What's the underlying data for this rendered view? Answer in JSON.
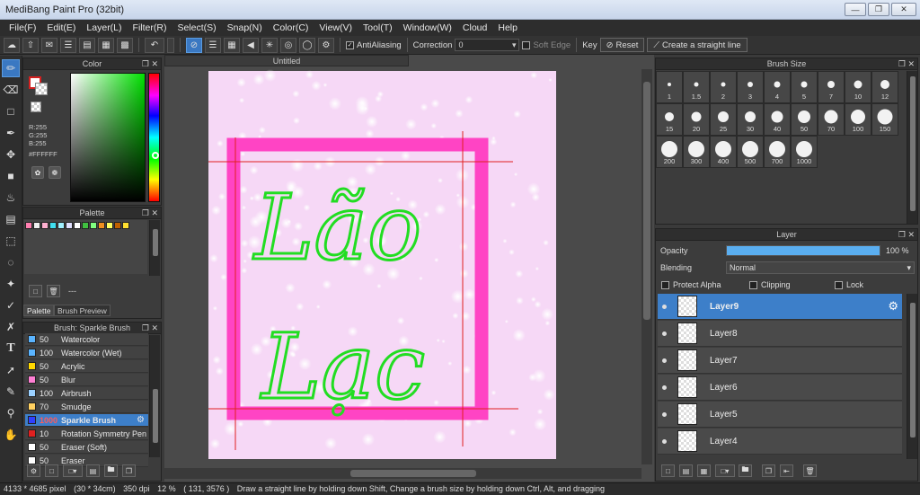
{
  "window": {
    "title": "MediBang Paint Pro (32bit)"
  },
  "menu": [
    "File(F)",
    "Edit(E)",
    "Layer(L)",
    "Filter(R)",
    "Select(S)",
    "Snap(N)",
    "Color(C)",
    "View(V)",
    "Tool(T)",
    "Window(W)",
    "Cloud",
    "Help"
  ],
  "toolbar": {
    "antialiasing_label": "AntiAliasing",
    "correction_label": "Correction",
    "correction_value": "0",
    "soft_edge_label": "Soft Edge",
    "key_label": "Key",
    "reset_label": "Reset",
    "straight_line_label": "Create a straight line"
  },
  "color_panel": {
    "title": "Color",
    "rgb": [
      "R:255",
      "G:255",
      "B:255"
    ],
    "hex": "#FFFFFF",
    "main_color": "#ffffff",
    "sub_color": "#ffffff"
  },
  "palette_panel": {
    "title": "Palette",
    "colors": [
      "#ff7fb0",
      "#f0f0f0",
      "#ffb0d0",
      "#40e0f0",
      "#a0f0ff",
      "#e0e0ff",
      "#ffffff",
      "#40c040",
      "#80ff80",
      "#f09020",
      "#ffff60",
      "#c06000",
      "#ffe030"
    ],
    "name_value": "---",
    "tabs": [
      "Palette",
      "Brush Preview"
    ]
  },
  "brush_panel": {
    "title": "Brush: Sparkle Brush",
    "items": [
      {
        "size": "50",
        "name": "Watercolor",
        "color": "#5ab4ff",
        "selected": false
      },
      {
        "size": "100",
        "name": "Watercolor (Wet)",
        "color": "#5ab4ff",
        "selected": false
      },
      {
        "size": "50",
        "name": "Acrylic",
        "color": "#ffd800",
        "selected": false
      },
      {
        "size": "50",
        "name": "Blur",
        "color": "#ff7fd4",
        "selected": false
      },
      {
        "size": "100",
        "name": "Airbrush",
        "color": "#9ad0ff",
        "selected": false
      },
      {
        "size": "70",
        "name": "Smudge",
        "color": "#ffd060",
        "selected": false
      },
      {
        "size": "1000",
        "name": "Sparkle Brush",
        "color": "#3040ff",
        "selected": true
      },
      {
        "size": "10",
        "name": "Rotation Symmetry Pen",
        "color": "#e02020",
        "selected": false
      },
      {
        "size": "50",
        "name": "Eraser (Soft)",
        "color": "#ffffff",
        "selected": false
      },
      {
        "size": "50",
        "name": "Eraser",
        "color": "#ffffff",
        "selected": false
      }
    ]
  },
  "document": {
    "tab_title": "Untitled",
    "text_line1": "Lão",
    "text_line2": "Lạc",
    "paper_color": "#f6d8f6",
    "frame_color": "#ff44c4",
    "ink_color": "#22dd22",
    "guide_color": "#e02020"
  },
  "brush_size_panel": {
    "title": "Brush Size",
    "sizes": [
      "1",
      "1.5",
      "2",
      "3",
      "4",
      "5",
      "7",
      "10",
      "12",
      "15",
      "20",
      "25",
      "30",
      "40",
      "50",
      "70",
      "100",
      "150",
      "200",
      "300",
      "400",
      "500",
      "700",
      "1000"
    ]
  },
  "layer_panel": {
    "title": "Layer",
    "opacity_label": "Opacity",
    "opacity_value": "100 %",
    "opacity_fraction": 1.0,
    "blending_label": "Blending",
    "blending_value": "Normal",
    "protect_alpha_label": "Protect Alpha",
    "clipping_label": "Clipping",
    "lock_label": "Lock",
    "layers": [
      {
        "name": "Layer9",
        "selected": true
      },
      {
        "name": "Layer8",
        "selected": false
      },
      {
        "name": "Layer7",
        "selected": false
      },
      {
        "name": "Layer6",
        "selected": false
      },
      {
        "name": "Layer5",
        "selected": false
      },
      {
        "name": "Layer4",
        "selected": false
      }
    ]
  },
  "status": {
    "size": "4133 * 4685 pixel",
    "cm": "(30 * 34cm)",
    "dpi": "350 dpi",
    "zoom": "12 %",
    "coords": "( 131, 3576 )",
    "hint": "Draw a straight line by holding down Shift, Change a brush size by holding down Ctrl, Alt, and dragging"
  }
}
